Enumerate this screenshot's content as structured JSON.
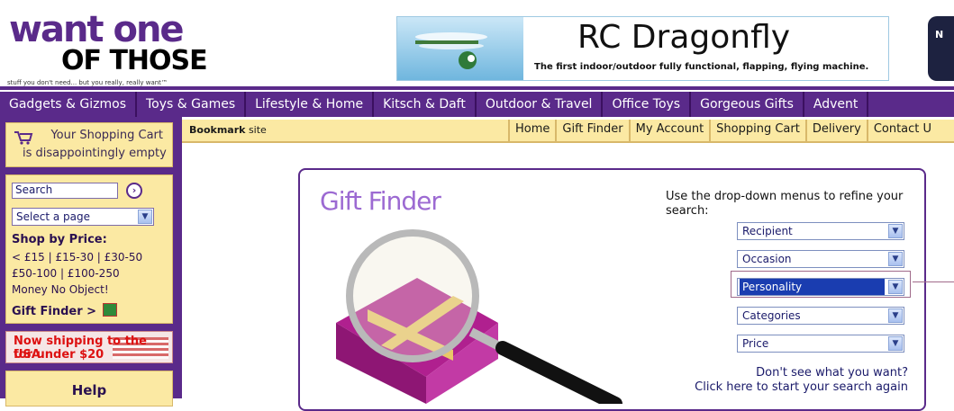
{
  "header": {
    "logo_line1": "want one",
    "logo_line2": "OF THOSE",
    "tagline": "stuff you don't need... but you really, really want™",
    "banner_title": "RC Dragonfly",
    "banner_subtitle": "The first indoor/outdoor fully functional, flapping, flying machine.",
    "badge_text": "N"
  },
  "nav": {
    "items": [
      "Gadgets & Gizmos",
      "Toys & Games",
      "Lifestyle & Home",
      "Kitsch & Daft",
      "Outdoor & Travel",
      "Office Toys",
      "Gorgeous Gifts",
      "Advent"
    ]
  },
  "sidebar": {
    "cart_line1": "Your Shopping Cart",
    "cart_line2": "is disappointingly empty",
    "search_value": "Search",
    "search_go": "›",
    "page_select": "Select a page",
    "shop_by_price": "Shop by Price:",
    "price_lines": [
      "< £15 | £15-30 | £30-50",
      "£50-100 | £100-250",
      "Money No Object!"
    ],
    "gift_finder_link": "Gift Finder >",
    "usa_line1": "Now shipping to the USA",
    "usa_line2": "for under $20",
    "help": "Help"
  },
  "linksbar": {
    "bookmark_bold": "Bookmark",
    "bookmark_rest": " site",
    "links": [
      "Home",
      "Gift Finder",
      "My Account",
      "Shopping Cart",
      "Delivery",
      "Contact U"
    ]
  },
  "gift_finder": {
    "title": "Gift Finder",
    "instructions": "Use the drop-down menus to refine your search:",
    "selects": [
      "Recipient",
      "Occasion",
      "Personality",
      "Categories",
      "Price"
    ],
    "active_select": "Personality",
    "dont_see_line1": "Don't see what you want?",
    "dont_see_line2": "Click here to start your search again"
  },
  "colors": {
    "brand_purple": "#5a2a8a",
    "sidebar_yellow": "#fbe9a3",
    "select_highlight": "#1a3db0"
  }
}
